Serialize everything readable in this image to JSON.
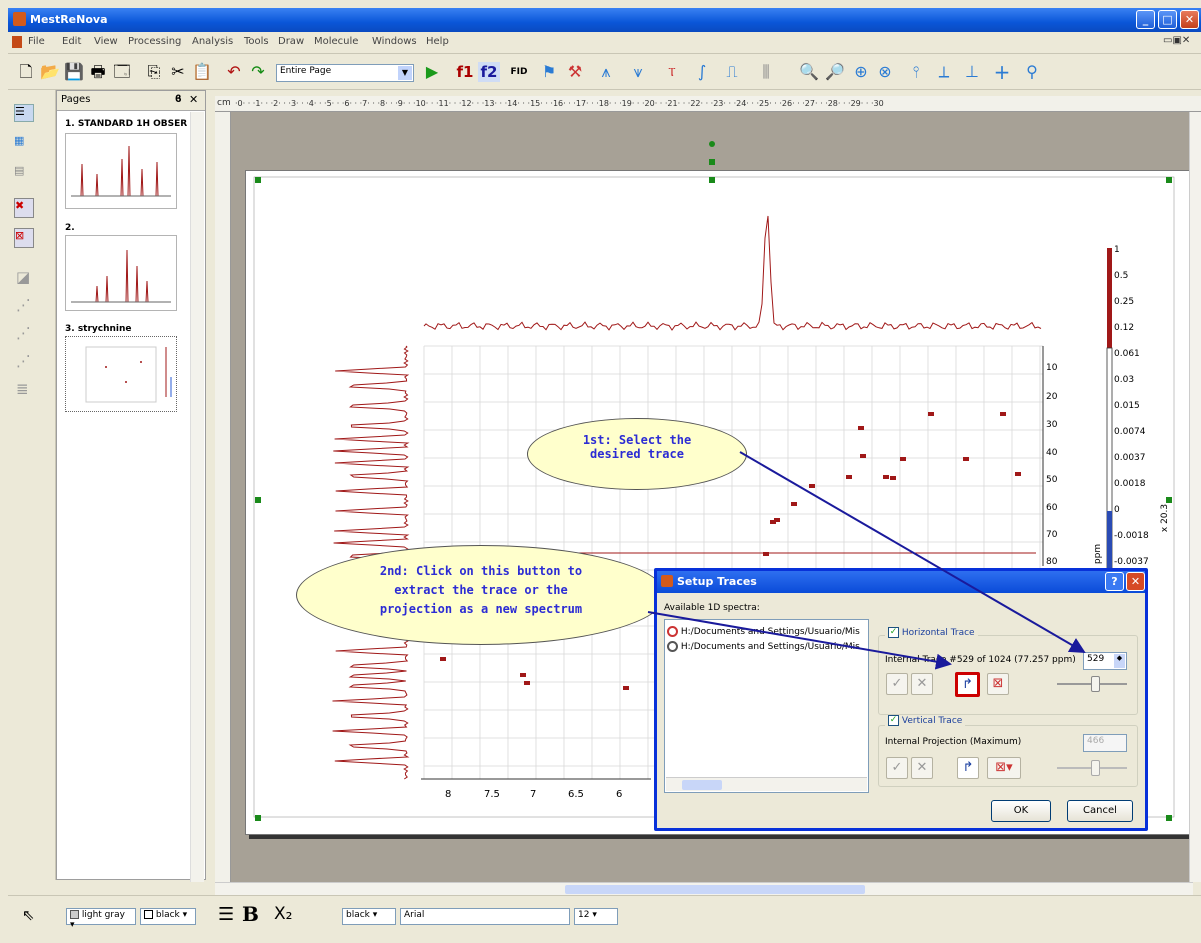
{
  "window": {
    "title": "MestReNova"
  },
  "menu": [
    "File",
    "Edit",
    "View",
    "Processing",
    "Analysis",
    "Tools",
    "Draw",
    "Molecule",
    "Windows",
    "Help"
  ],
  "toolbar": {
    "zoom_combo": "Entire Page",
    "f1": "f1",
    "f2": "f2",
    "fid": "FID"
  },
  "pages_panel": {
    "title": "Pages",
    "items": [
      {
        "label": "1. STANDARD 1H OBSER"
      },
      {
        "label": "2."
      },
      {
        "label": "3. strychnine"
      }
    ]
  },
  "ruler": {
    "unit": "cm"
  },
  "spectrum": {
    "x_ticks": [
      "8",
      "7.5",
      "7",
      "6.5",
      "6"
    ],
    "y_ticks": [
      "10",
      "20",
      "30",
      "40",
      "50",
      "60",
      "70",
      "80"
    ],
    "y_unit": "ppm",
    "colorbar": [
      "1",
      "0.5",
      "0.25",
      "0.12",
      "0.061",
      "0.03",
      "0.015",
      "0.0074",
      "0.0037",
      "0.0018",
      "0",
      "-0.0018",
      "-0.0037"
    ],
    "scale_label": "x 20.3"
  },
  "callouts": {
    "first": "1st: Select the desired trace",
    "second": "2nd: Click on this button to extract the trace or the projection as a new spectrum"
  },
  "dialog": {
    "title": "Setup Traces",
    "available_label": "Available 1D spectra:",
    "spectra": [
      "H:/Documents and Settings/Usuario/Mis",
      "H:/Documents and Settings/Usuario/Mis"
    ],
    "horizontal": {
      "label": "Horizontal Trace",
      "info": "Internal Trace #529 of 1024 (77.257 ppm)",
      "value": "529"
    },
    "vertical": {
      "label": "Vertical Trace",
      "info": "Internal Projection (Maximum)",
      "value": "466"
    },
    "ok": "OK",
    "cancel": "Cancel"
  },
  "statusbar": {
    "fill_color": "light gray",
    "line_color": "black",
    "text_color": "black",
    "font": "Arial",
    "size": "12"
  },
  "colors": {
    "accent": "#0a4ac0",
    "spectrum": "#a01818",
    "callout": "#ffffcc",
    "arrow": "#1a1a9c"
  }
}
